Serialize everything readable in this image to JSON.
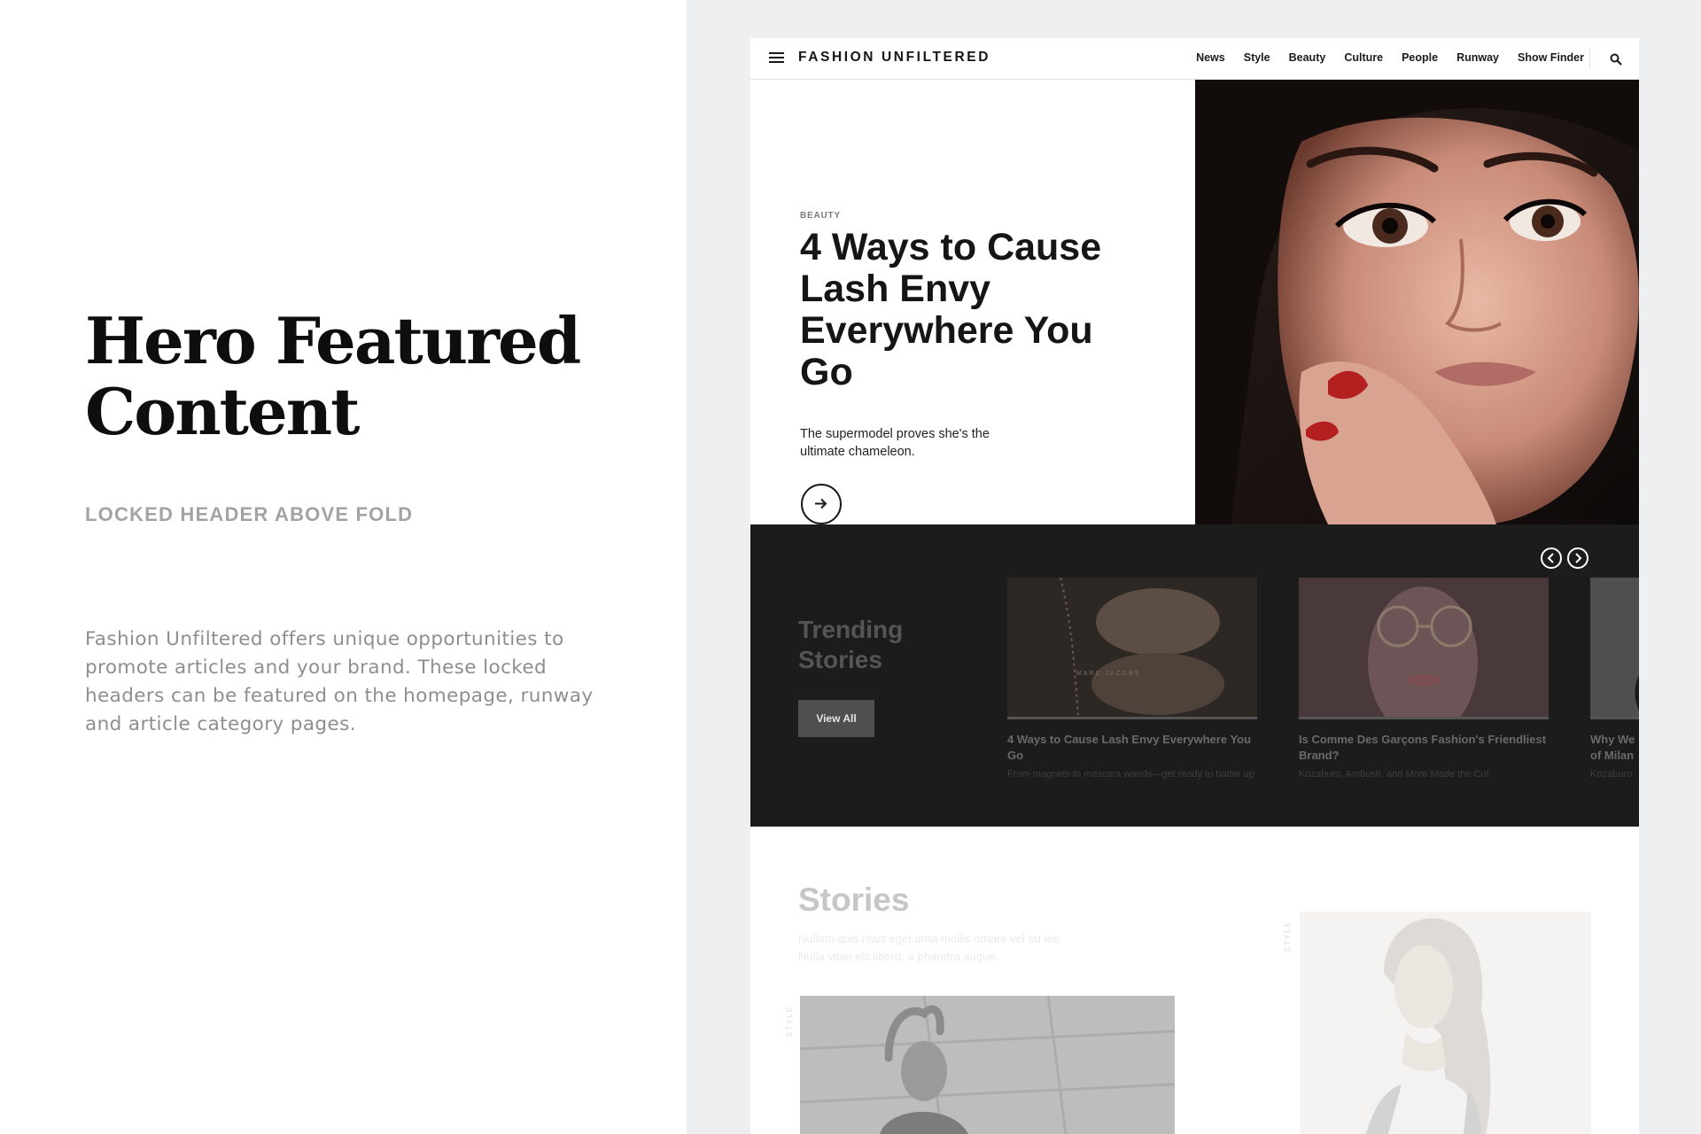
{
  "left": {
    "title": "Hero Featured Content",
    "subtitle": "LOCKED HEADER ABOVE FOLD",
    "body": "Fashion Unfiltered offers unique opportunities to promote articles and your brand. These locked headers can be featured on the homepage, runway and article category pages."
  },
  "header": {
    "brand": "FASHION UNFILTERED",
    "nav": [
      "News",
      "Style",
      "Beauty",
      "Culture",
      "People",
      "Runway",
      "Show Finder"
    ]
  },
  "hero": {
    "category": "BEAUTY",
    "title": "4 Ways to Cause Lash Envy Everywhere You Go",
    "dek": "The supermodel proves she's the ultimate chameleon."
  },
  "trending": {
    "title": "Trending Stories",
    "view_all": "View All",
    "cards": [
      {
        "title": "4 Ways to Cause Lash Envy Everywhere You Go",
        "desc": "From magnets to mascara wands—get ready to batter up"
      },
      {
        "title": "Is Comme Des Garçons Fashion's Friendliest Brand?",
        "desc": "Kozaburo, Ambush, and More Made the Cut"
      },
      {
        "title": "Why We\nof Milan",
        "desc": "Kozaburo"
      }
    ],
    "card_image_text": "MARC JACOBS"
  },
  "stories": {
    "title": "Stories",
    "desc": "Nullam quis risus eget urna mollis ornare vel eu leo. Nulla vitae elit libero, a pharetra augue.",
    "tag1": "STYLE",
    "tag2": "STYLE"
  },
  "colors": {
    "page_bg": "#eeeff1",
    "trending_bg": "#1c1c1c",
    "text_dark": "#151515",
    "text_muted": "#8e8e8e"
  },
  "icons": [
    "menu-icon",
    "search-icon",
    "arrow-right-icon",
    "chevron-left-icon",
    "chevron-right-icon"
  ]
}
